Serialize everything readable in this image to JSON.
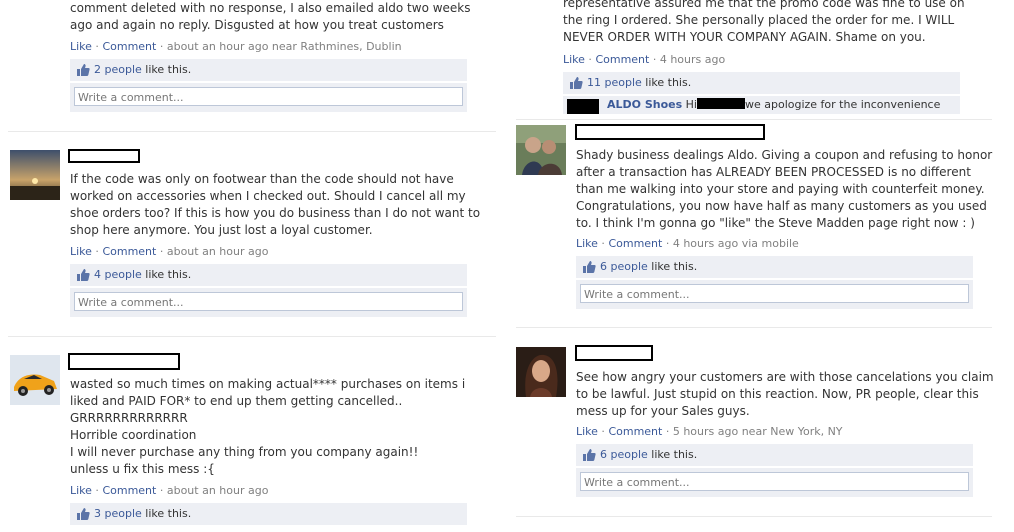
{
  "colors": {
    "link": "#3b5998",
    "meta": "#808080",
    "likes_bg": "#edeff4",
    "input_border": "#bdc7d8",
    "divider": "#e9e9e9"
  },
  "actions": {
    "like": "Like",
    "comment": "Comment",
    "sep": " · "
  },
  "likes_suffix": "like this.",
  "comment_placeholder": "Write a comment...",
  "left_posts": [
    {
      "body": "comment deleted with no response, I also emailed aldo two weeks\nago and again no reply. Disgusted at how you treat customers",
      "time": "about an hour ago near Rathmines, Dublin",
      "likes": "2 people"
    },
    {
      "body": "If the code was only on footwear than the code should not have\nworked on accessories when I checked out. Should I cancel all my\nshoe orders too? If this is how you do business than I do not want to\nshop here anymore. You just lost a loyal customer.",
      "time": "about an hour ago",
      "likes": "4 people"
    },
    {
      "body": "wasted so much times on making actual**** purchases on items i\nliked and PAID FOR* to end up them getting cancelled..\nGRRRRRRRRRRRRR\nHorrible coordination\nI will never purchase any thing from you company again!!\nunless u fix this mess :{",
      "time": "about an hour ago",
      "likes": "3 people"
    }
  ],
  "right_posts": [
    {
      "body": "representative assured me that the promo code was fine to use on\nthe ring I ordered. She personally placed the order for me. I WILL\nNEVER ORDER WITH YOUR COMPANY AGAIN. Shame on you.",
      "time": "4 hours ago",
      "likes": "11 people",
      "reply": {
        "name": "ALDO Shoes",
        "greeting": "Hi",
        "text": "we apologize for the inconvenience"
      }
    },
    {
      "body": "Shady business dealings Aldo. Giving a coupon and refusing to honor\nafter a transaction has ALREADY BEEN PROCESSED is no different\nthan me walking into your store and paying with counterfeit money.\nCongratulations, you now have half as many customers as you used\nto. I think I'm gonna go \"like\" the Steve Madden page right now : )",
      "time": "4 hours ago via mobile",
      "likes": "6 people"
    },
    {
      "body": "See how angry your customers are with those cancelations you claim\nto be lawful. Just stupid on this reaction. Now, PR people, clear this\nmess up for your Sales guys.",
      "time": "5 hours ago near New York, NY",
      "likes": "6 people"
    }
  ]
}
